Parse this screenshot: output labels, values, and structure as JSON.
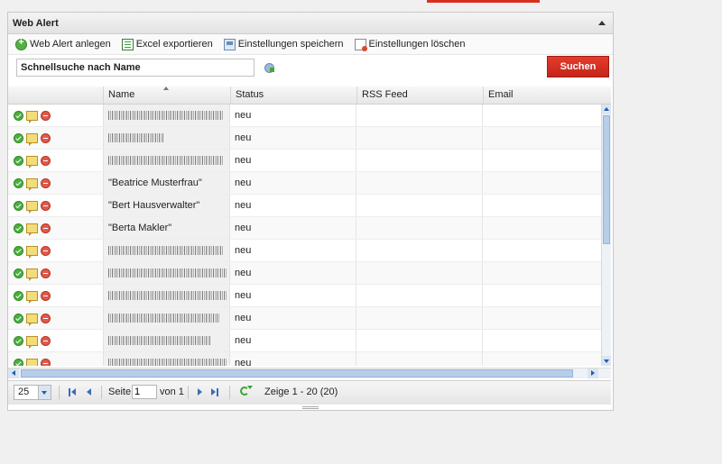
{
  "panel": {
    "title": "Web Alert"
  },
  "toolbar": {
    "add_label": "Web Alert anlegen",
    "excel_label": "Excel exportieren",
    "save_label": "Einstellungen speichern",
    "delete_label": "Einstellungen löschen"
  },
  "search": {
    "value": "Schnellsuche nach Name",
    "button_label": "Suchen"
  },
  "grid": {
    "columns": [
      "",
      "Name",
      "Status",
      "RSS Feed",
      "Email"
    ],
    "rows": [
      {
        "name": "",
        "name_redacted": true,
        "status": "neu",
        "rss": "",
        "email": ""
      },
      {
        "name": "",
        "name_redacted": true,
        "status": "neu",
        "rss": "",
        "email": ""
      },
      {
        "name": "",
        "name_redacted": true,
        "status": "neu",
        "rss": "",
        "email": ""
      },
      {
        "name": "\"Beatrice Musterfrau\"",
        "name_redacted": false,
        "status": "neu",
        "rss": "",
        "email": ""
      },
      {
        "name": "\"Bert Hausverwalter\"",
        "name_redacted": false,
        "status": "neu",
        "rss": "",
        "email": ""
      },
      {
        "name": "\"Berta Makler\"",
        "name_redacted": false,
        "status": "neu",
        "rss": "",
        "email": ""
      },
      {
        "name": "",
        "name_redacted": true,
        "status": "neu",
        "rss": "",
        "email": ""
      },
      {
        "name": "",
        "name_redacted": true,
        "status": "neu",
        "rss": "",
        "email": ""
      },
      {
        "name": "",
        "name_redacted": true,
        "status": "neu",
        "rss": "",
        "email": ""
      },
      {
        "name": "",
        "name_redacted": true,
        "status": "neu",
        "rss": "",
        "email": ""
      },
      {
        "name": "",
        "name_redacted": true,
        "status": "neu",
        "rss": "",
        "email": ""
      },
      {
        "name": "",
        "name_redacted": true,
        "status": "neu",
        "rss": "",
        "email": ""
      }
    ]
  },
  "pager": {
    "page_size": "25",
    "page_label": "Seite",
    "page_value": "1",
    "of_label": "von 1",
    "display_info": "Zeige 1 - 20 (20)"
  },
  "colors": {
    "accent_red": "#d9301e",
    "scroll_blue": "#b7cde8",
    "header_gray": "#e7e7e7"
  }
}
